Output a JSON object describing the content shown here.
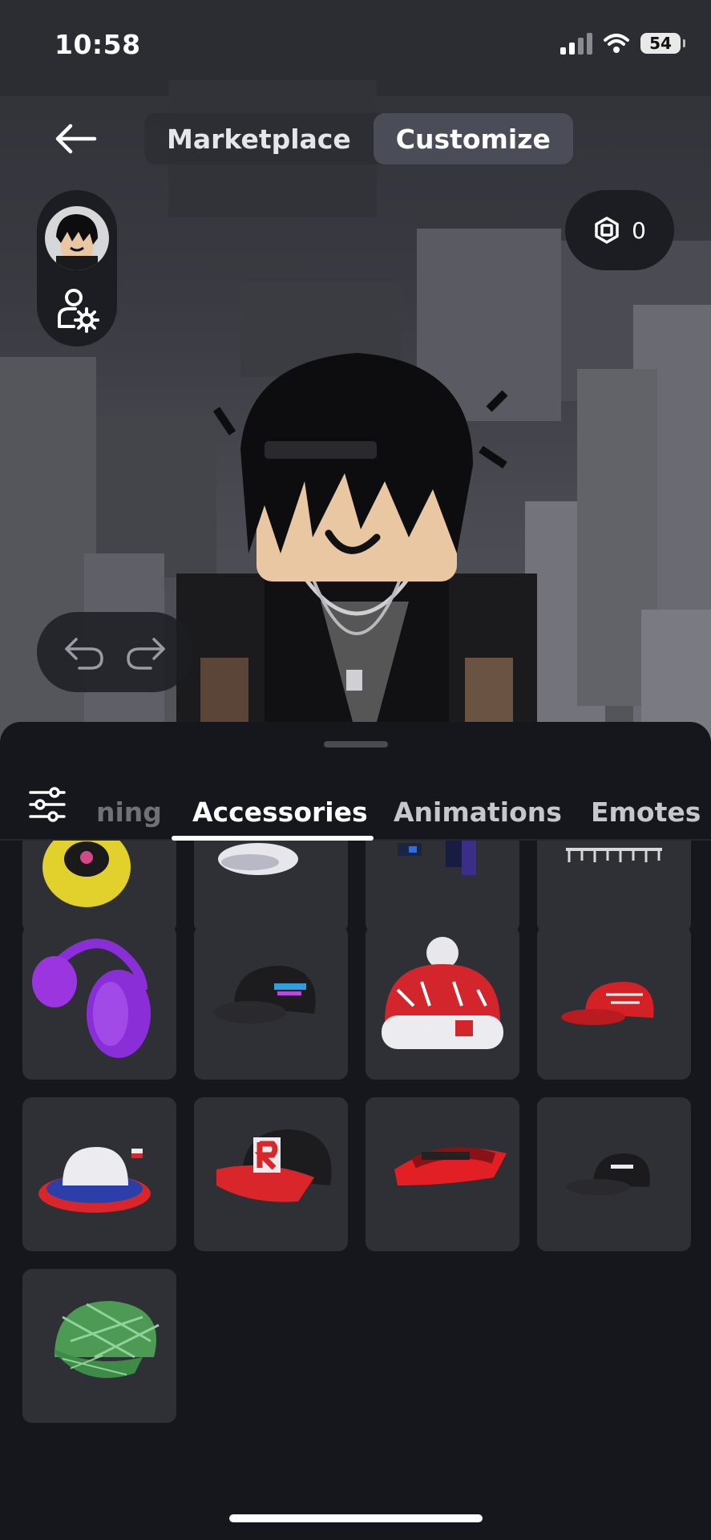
{
  "status_bar": {
    "time": "10:58",
    "battery": "54"
  },
  "nav": {
    "tabs": [
      {
        "label": "Marketplace",
        "active": false
      },
      {
        "label": "Customize",
        "active": true
      }
    ]
  },
  "robux": {
    "amount": "0"
  },
  "categories": {
    "partial_label": "ning",
    "tabs": [
      {
        "label": "Accessories",
        "active": true
      },
      {
        "label": "Animations",
        "active": false
      },
      {
        "label": "Emotes",
        "active": false
      }
    ]
  },
  "items": [
    {
      "icon": "yellow-ring-hat-icon"
    },
    {
      "icon": "white-cap-icon"
    },
    {
      "icon": "blue-glasses-icon"
    },
    {
      "icon": "silver-chain-icon"
    },
    {
      "icon": "purple-headphones-icon"
    },
    {
      "icon": "black-cap-icon"
    },
    {
      "icon": "red-beanie-icon"
    },
    {
      "icon": "red-cap-icon"
    },
    {
      "icon": "fedora-hat-icon"
    },
    {
      "icon": "roblox-r-cap-icon"
    },
    {
      "icon": "red-visor-icon"
    },
    {
      "icon": "roblox-black-cap-icon"
    },
    {
      "icon": "green-plaid-cap-icon"
    }
  ]
}
